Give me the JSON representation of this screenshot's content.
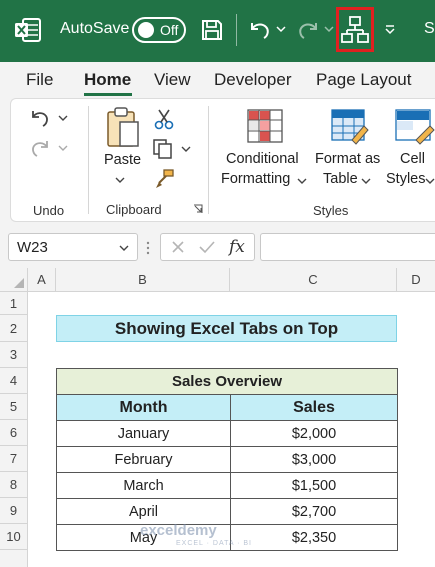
{
  "titlebar": {
    "autosave_label": "AutoSave",
    "toggle_state": "Off",
    "right_text": "S"
  },
  "tabs": [
    "File",
    "Home",
    "View",
    "Developer",
    "Page Layout"
  ],
  "active_tab": "Home",
  "ribbon": {
    "undo_group_label": "Undo",
    "clipboard": {
      "paste_label": "Paste",
      "group_label": "Clipboard"
    },
    "styles": {
      "conditional_line1": "Conditional",
      "conditional_line2": "Formatting",
      "format_table_line1": "Format as",
      "format_table_line2": "Table",
      "cell_styles_line1": "Cell",
      "cell_styles_line2": "Styles",
      "group_label": "Styles"
    }
  },
  "formula_bar": {
    "name_box": "W23",
    "fx": "fx",
    "formula": ""
  },
  "columns": [
    "A",
    "B",
    "C",
    "D"
  ],
  "rows": [
    "1",
    "2",
    "3",
    "4",
    "5",
    "6",
    "7",
    "8",
    "9",
    "10"
  ],
  "sheet": {
    "title": "Showing Excel Tabs on Top",
    "table_caption": "Sales Overview",
    "headers": [
      "Month",
      "Sales"
    ],
    "data": [
      [
        "January",
        "$2,000"
      ],
      [
        "February",
        "$3,000"
      ],
      [
        "March",
        "$1,500"
      ],
      [
        "April",
        "$2,700"
      ],
      [
        "May",
        "$2,350"
      ]
    ]
  },
  "watermark": {
    "name": "exceldemy",
    "tagline": "EXCEL · DATA · BI"
  },
  "colors": {
    "excel_green": "#217346",
    "highlight_red": "#e02020",
    "title_fill": "#c4eef7",
    "caption_fill": "#e7f0d8"
  }
}
